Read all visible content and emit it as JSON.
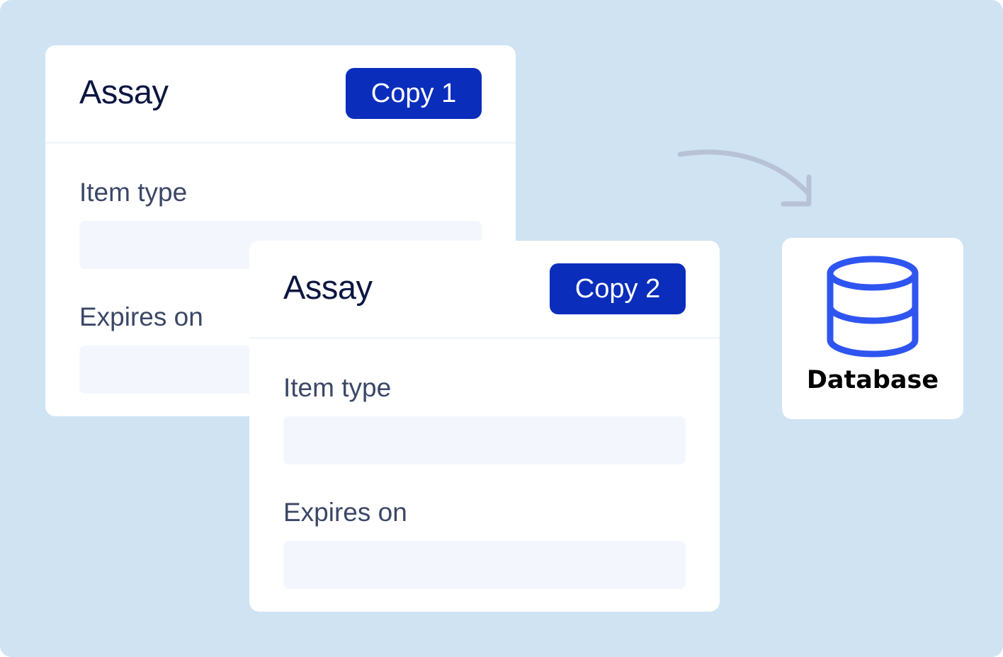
{
  "cards": [
    {
      "title": "Assay",
      "copy_label": "Copy 1",
      "fields": [
        {
          "label": "Item type",
          "value": ""
        },
        {
          "label": "Expires on",
          "value": ""
        }
      ]
    },
    {
      "title": "Assay",
      "copy_label": "Copy 2",
      "fields": [
        {
          "label": "Item type",
          "value": ""
        },
        {
          "label": "Expires on",
          "value": ""
        }
      ]
    }
  ],
  "database": {
    "label": "Database",
    "icon": "database-icon"
  },
  "colors": {
    "background": "#cfe3f3",
    "copy_button": "#0a2dbb",
    "title_text": "#0b1640",
    "label_text": "#3b4766",
    "input_fill": "#f3f7fd",
    "database_icon": "#2f55f0",
    "arrow": "#b8c2d6"
  }
}
